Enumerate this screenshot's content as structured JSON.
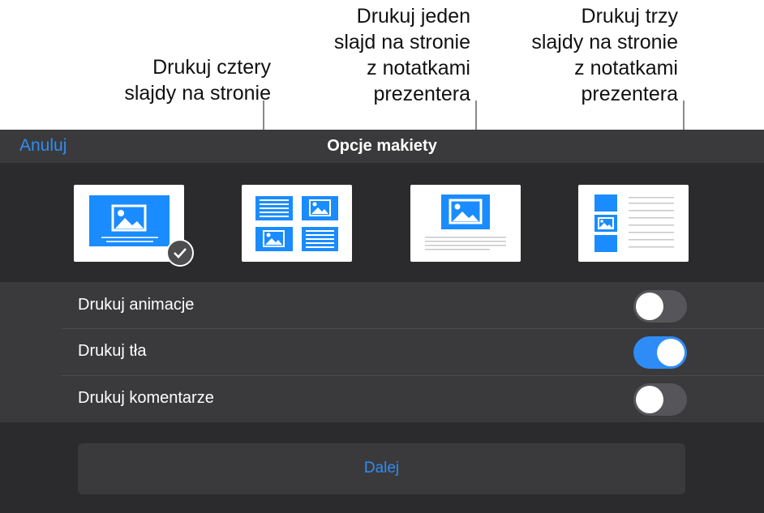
{
  "callouts": {
    "four_slides": "Drukuj cztery\nslajdy na stronie",
    "one_slide_notes": "Drukuj jeden\nslajd na stronie\nz notatkami\nprezentera",
    "three_slides_notes": "Drukuj trzy\nslajdy na stronie\nz notatkami\nprezentera"
  },
  "header": {
    "cancel_label": "Anuluj",
    "title": "Opcje makiety"
  },
  "layouts": [
    {
      "icon": "single-slide-layout-icon",
      "selected": true
    },
    {
      "icon": "four-slides-layout-icon",
      "selected": false
    },
    {
      "icon": "slide-with-notes-layout-icon",
      "selected": false
    },
    {
      "icon": "three-slides-with-notes-layout-icon",
      "selected": false
    }
  ],
  "options": [
    {
      "label": "Drukuj animacje",
      "enabled": false
    },
    {
      "label": "Drukuj tła",
      "enabled": true
    },
    {
      "label": "Drukuj komentarze",
      "enabled": false
    }
  ],
  "next_label": "Dalej",
  "colors": {
    "accent": "#2f8cf6",
    "panel_background": "#2b2b2d",
    "row_background": "#3a3a3c",
    "slide_blue": "#1a8cff"
  }
}
